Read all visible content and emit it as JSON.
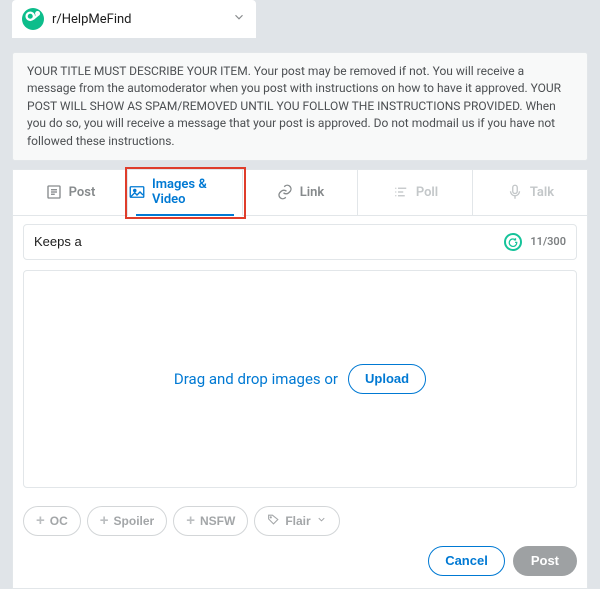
{
  "community": {
    "name": "r/HelpMeFind",
    "icon_letter": "G"
  },
  "rules_text": "YOUR TITLE MUST DESCRIBE YOUR ITEM. Your post may be removed if not. You will receive a message from the automoderator when you post with instructions on how to have it approved. YOUR POST WILL SHOW AS SPAM/REMOVED UNTIL YOU FOLLOW THE INSTRUCTIONS PROVIDED. When you do so, you will receive a message that your post is approved. Do not modmail us if you have not followed these instructions.",
  "tabs": {
    "post": "Post",
    "images": "Images & Video",
    "link": "Link",
    "poll": "Poll",
    "talk": "Talk"
  },
  "title": {
    "value": "Keeps a",
    "counter": "11/300"
  },
  "dropzone": {
    "text": "Drag and drop images or",
    "upload": "Upload"
  },
  "tags": {
    "oc": "OC",
    "spoiler": "Spoiler",
    "nsfw": "NSFW",
    "flair": "Flair"
  },
  "actions": {
    "cancel": "Cancel",
    "post": "Post"
  }
}
